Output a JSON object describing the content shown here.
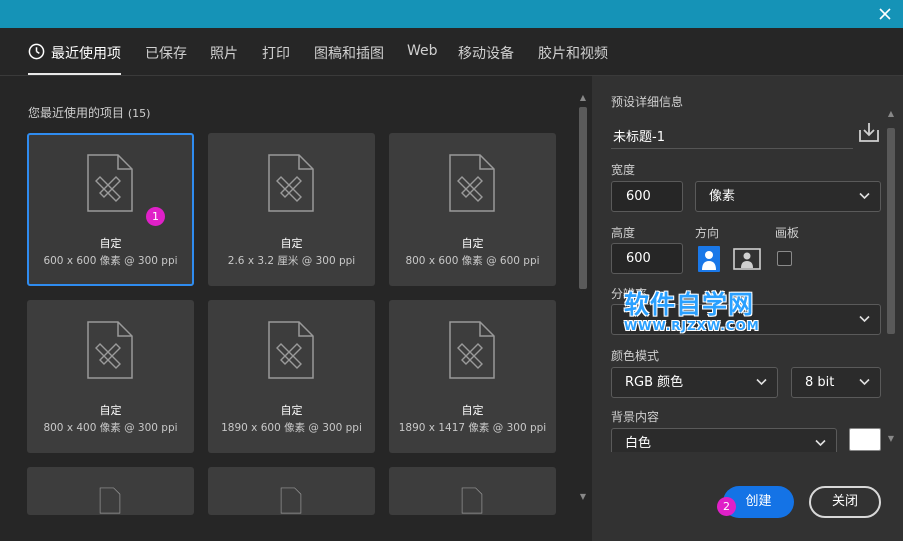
{
  "tabs": [
    {
      "label": "最近使用项"
    },
    {
      "label": "已保存"
    },
    {
      "label": "照片"
    },
    {
      "label": "打印"
    },
    {
      "label": "图稿和插图"
    },
    {
      "label": "Web"
    },
    {
      "label": "移动设备"
    },
    {
      "label": "胶片和视频"
    }
  ],
  "recent": {
    "title": "您最近使用的项目",
    "count": "(15)",
    "cards": [
      {
        "name": "自定",
        "size": "600 x 600 像素 @ 300 ppi"
      },
      {
        "name": "自定",
        "size": "2.6 x 3.2 厘米 @ 300 ppi"
      },
      {
        "name": "自定",
        "size": "800 x 600 像素 @ 600 ppi"
      },
      {
        "name": "自定",
        "size": "800 x 400 像素 @ 300 ppi"
      },
      {
        "name": "自定",
        "size": "1890 x 600 像素 @ 300 ppi"
      },
      {
        "name": "自定",
        "size": "1890 x 1417 像素 @ 300 ppi"
      }
    ]
  },
  "badges": {
    "one": "1",
    "two": "2"
  },
  "preset": {
    "header": "预设详细信息",
    "name": "未标题-1",
    "width_label": "宽度",
    "width_value": "600",
    "width_unit": "像素",
    "height_label": "高度",
    "height_value": "600",
    "orientation_label": "方向",
    "artboard_label": "画板",
    "resolution_label": "分辨率",
    "resolution_value": "",
    "color_mode_label": "颜色模式",
    "color_mode_value": "RGB 颜色",
    "bit_depth_value": "8 bit",
    "background_label": "背景内容",
    "background_value": "白色"
  },
  "actions": {
    "create": "创建",
    "close": "关闭"
  },
  "watermark": {
    "big": "软件自学网",
    "small": "WWW.RJZXW.COM"
  },
  "colors": {
    "titlebar": "#1593b7",
    "accent": "#1473e6",
    "badge": "#e020c8",
    "selected_border": "#2f8cf0"
  }
}
